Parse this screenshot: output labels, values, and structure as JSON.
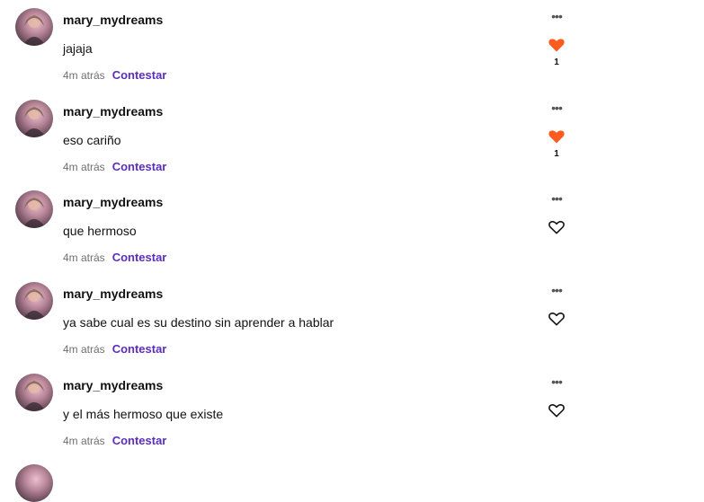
{
  "comments": [
    {
      "username": "mary_mydreams",
      "text": "jajaja",
      "time": "4m atrás",
      "reply_label": "Contestar",
      "liked": true,
      "like_count": "1"
    },
    {
      "username": "mary_mydreams",
      "text": "eso cariño",
      "time": "4m atrás",
      "reply_label": "Contestar",
      "liked": true,
      "like_count": "1"
    },
    {
      "username": "mary_mydreams",
      "text": "que hermoso",
      "time": "4m atrás",
      "reply_label": "Contestar",
      "liked": false,
      "like_count": ""
    },
    {
      "username": "mary_mydreams",
      "text": "ya sabe cual es su destino sin aprender a hablar",
      "time": "4m atrás",
      "reply_label": "Contestar",
      "liked": false,
      "like_count": ""
    },
    {
      "username": "mary_mydreams",
      "text": "y el más hermoso que existe",
      "time": "4m atrás",
      "reply_label": "Contestar",
      "liked": false,
      "like_count": ""
    }
  ],
  "colors": {
    "accent": "#5a2dbd",
    "like": "#ff5a1f"
  },
  "icons": {
    "more": "more-options-icon",
    "like": "heart-icon"
  }
}
